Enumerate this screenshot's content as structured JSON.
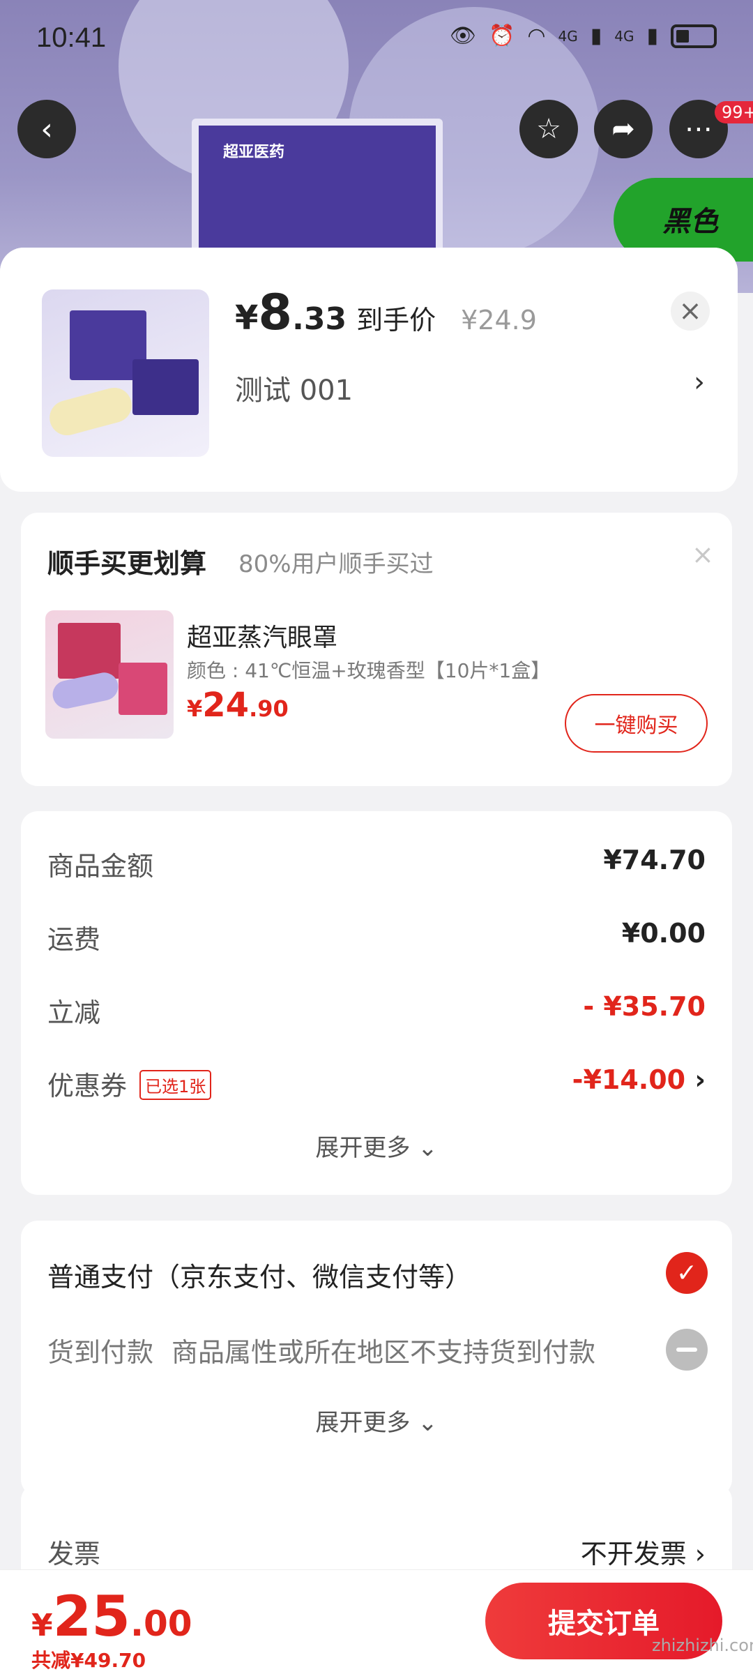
{
  "status_bar": {
    "time": "10:41",
    "network": "4G",
    "network2": "4G"
  },
  "hero": {
    "brand_text": "超亚医药",
    "color_tag": "黑色",
    "badge": "99+"
  },
  "product": {
    "currency": "¥",
    "price_int": "8",
    "price_dec": ".33",
    "price_label": "到手价",
    "original_price": "¥24.9",
    "spec": "测试  001"
  },
  "addon": {
    "title": "顺手买更划算",
    "subtitle": "80%用户顺手买过",
    "name": "超亚蒸汽眼罩",
    "spec": "颜色 : 41℃恒温+玫瑰香型【10片*1盒】",
    "currency": "¥",
    "price_int": "24",
    "price_dec": ".90",
    "buy_label": "一键购买"
  },
  "amounts": {
    "goods_label": "商品金额",
    "goods_value": "¥74.70",
    "shipping_label": "运费",
    "shipping_value": "¥0.00",
    "discount_label": "立减",
    "discount_value": "- ¥35.70",
    "coupon_label": "优惠券",
    "coupon_tag": "已选1张",
    "coupon_value": "-¥14.00",
    "more_label": "展开更多"
  },
  "payment": {
    "normal_label": "普通支付（京东支付、微信支付等）",
    "cod_label": "货到付款",
    "cod_note": "商品属性或所在地区不支持货到付款",
    "more_label": "展开更多"
  },
  "invoice": {
    "label": "发票",
    "value": "不开发票"
  },
  "footer": {
    "currency": "¥",
    "total_int": "25",
    "total_dec": ".00",
    "saving": "共减¥49.70",
    "submit_label": "提交订单",
    "watermark": "zhizhizhi.com"
  },
  "colors": {
    "accent": "#e1251b",
    "background": "#f2f2f4"
  }
}
